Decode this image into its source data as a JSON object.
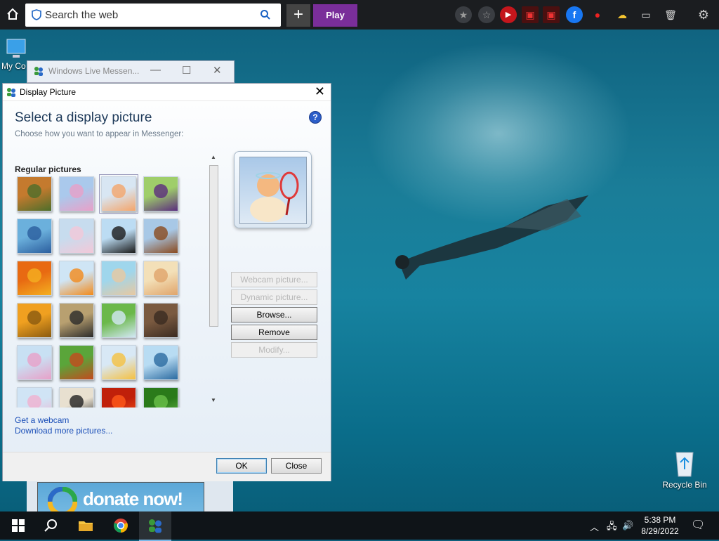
{
  "top_bar": {
    "search_placeholder": "Search the web",
    "play_label": "Play",
    "icons": [
      "home-icon",
      "shield-icon",
      "search-icon",
      "plus-icon",
      "star-icon",
      "star-outline-icon",
      "youtube-icon",
      "video-icon",
      "video-icon",
      "facebook-icon",
      "ladybug-icon",
      "weather-icon",
      "folder-icon",
      "trash-icon",
      "gear-icon"
    ]
  },
  "desktop": {
    "my_computer_label": "My Co",
    "recycle_bin_label": "Recycle Bin"
  },
  "messenger_window": {
    "title": "Windows Live Messen...",
    "donate_text": "donate now!"
  },
  "dialog": {
    "title": "Display Picture",
    "heading": "Select a display picture",
    "subtitle": "Choose how you want to appear in Messenger:",
    "group_label": "Regular pictures",
    "pictures": [
      {
        "name": "bonsai",
        "colors": [
          "#c47a2e",
          "#4d6e2a"
        ]
      },
      {
        "name": "surfboard",
        "colors": [
          "#aac9ec",
          "#e9a0c8"
        ]
      },
      {
        "name": "tennis",
        "colors": [
          "#d8e6f3",
          "#f4a56a"
        ]
      },
      {
        "name": "robot-girl",
        "colors": [
          "#9fce6a",
          "#5b2d7e"
        ]
      },
      {
        "name": "basketball",
        "colors": [
          "#6bb0dc",
          "#2b5e9e"
        ]
      },
      {
        "name": "chef",
        "colors": [
          "#c7dcee",
          "#f3c8d8"
        ]
      },
      {
        "name": "suit",
        "colors": [
          "#bcdcf3",
          "#1a1a1a"
        ]
      },
      {
        "name": "suitcase",
        "colors": [
          "#a8c8e6",
          "#8a4a1e"
        ]
      },
      {
        "name": "daisy",
        "colors": [
          "#e86a12",
          "#f4b020"
        ]
      },
      {
        "name": "goldfish",
        "colors": [
          "#cfe5f5",
          "#f28a1a"
        ]
      },
      {
        "name": "beach",
        "colors": [
          "#9fd6ec",
          "#e8c8a0"
        ]
      },
      {
        "name": "sand-castle",
        "colors": [
          "#f3e0b8",
          "#e0a46a"
        ]
      },
      {
        "name": "bass-clef",
        "colors": [
          "#f0a020",
          "#8a5a10"
        ]
      },
      {
        "name": "chess",
        "colors": [
          "#b8a070",
          "#2a2a2a"
        ]
      },
      {
        "name": "soccer",
        "colors": [
          "#6bb84a",
          "#d3e8f5"
        ]
      },
      {
        "name": "kitten",
        "colors": [
          "#7a5a40",
          "#3a2a20"
        ]
      },
      {
        "name": "guitar",
        "colors": [
          "#c8e0f3",
          "#e8a0c8"
        ]
      },
      {
        "name": "sports-balls",
        "colors": [
          "#5aa53a",
          "#c44a1e"
        ]
      },
      {
        "name": "blocks",
        "colors": [
          "#d8e8f5",
          "#f5c040"
        ]
      },
      {
        "name": "rock-guitar",
        "colors": [
          "#b8dcf3",
          "#2a6aa0"
        ]
      },
      {
        "name": "pink-person",
        "colors": [
          "#d0e4f5",
          "#f0b0d0"
        ]
      },
      {
        "name": "cartoon-face",
        "colors": [
          "#e8e0d0",
          "#222222"
        ]
      },
      {
        "name": "red-coral",
        "colors": [
          "#c0200a",
          "#ff5a1a"
        ]
      },
      {
        "name": "green-leaf",
        "colors": [
          "#2a7a1a",
          "#6ac04a"
        ]
      }
    ],
    "selected_picture": "tennis",
    "buttons": {
      "webcam": "Webcam picture...",
      "dynamic": "Dynamic picture...",
      "browse": "Browse...",
      "remove": "Remove",
      "modify": "Modify..."
    },
    "links": {
      "webcam": "Get a webcam",
      "download": "Download more pictures..."
    },
    "ok_label": "OK",
    "close_label": "Close"
  },
  "taskbar": {
    "time": "5:38 PM",
    "date": "8/29/2022",
    "icons": [
      "windows-start-icon",
      "search-icon",
      "file-explorer-icon",
      "chrome-icon",
      "messenger-icon"
    ]
  }
}
